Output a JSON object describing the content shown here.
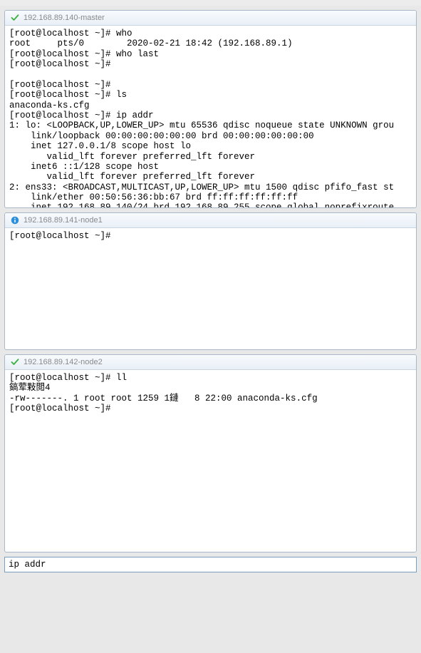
{
  "panes": [
    {
      "title": "192.168.89.140-master",
      "icon": "check",
      "lines": [
        "[root@localhost ~]# who",
        "root     pts/0        2020-02-21 18:42 (192.168.89.1)",
        "[root@localhost ~]# who last",
        "[root@localhost ~]#",
        "",
        "[root@localhost ~]#",
        "[root@localhost ~]# ls",
        "anaconda-ks.cfg",
        "[root@localhost ~]# ip addr",
        "1: lo: <LOOPBACK,UP,LOWER_UP> mtu 65536 qdisc noqueue state UNKNOWN grou",
        "    link/loopback 00:00:00:00:00:00 brd 00:00:00:00:00:00",
        "    inet 127.0.0.1/8 scope host lo",
        "       valid_lft forever preferred_lft forever",
        "    inet6 ::1/128 scope host",
        "       valid_lft forever preferred_lft forever",
        "2: ens33: <BROADCAST,MULTICAST,UP,LOWER_UP> mtu 1500 qdisc pfifo_fast st",
        "    link/ether 00:50:56:36:bb:67 brd ff:ff:ff:ff:ff:ff",
        "    inet 192.168.89.140/24 brd 192.168.89.255 scope global noprefixroute"
      ]
    },
    {
      "title": "192.168.89.141-node1",
      "icon": "info",
      "lines": [
        "[root@localhost ~]#"
      ]
    },
    {
      "title": "192.168.89.142-node2",
      "icon": "check",
      "lines": [
        "[root@localhost ~]# ll",
        "鎬荤敤閲4",
        "-rw-------. 1 root root 1259 1鏈   8 22:00 anaconda-ks.cfg",
        "[root@localhost ~]#"
      ]
    }
  ],
  "command_input": {
    "value": "ip addr"
  }
}
